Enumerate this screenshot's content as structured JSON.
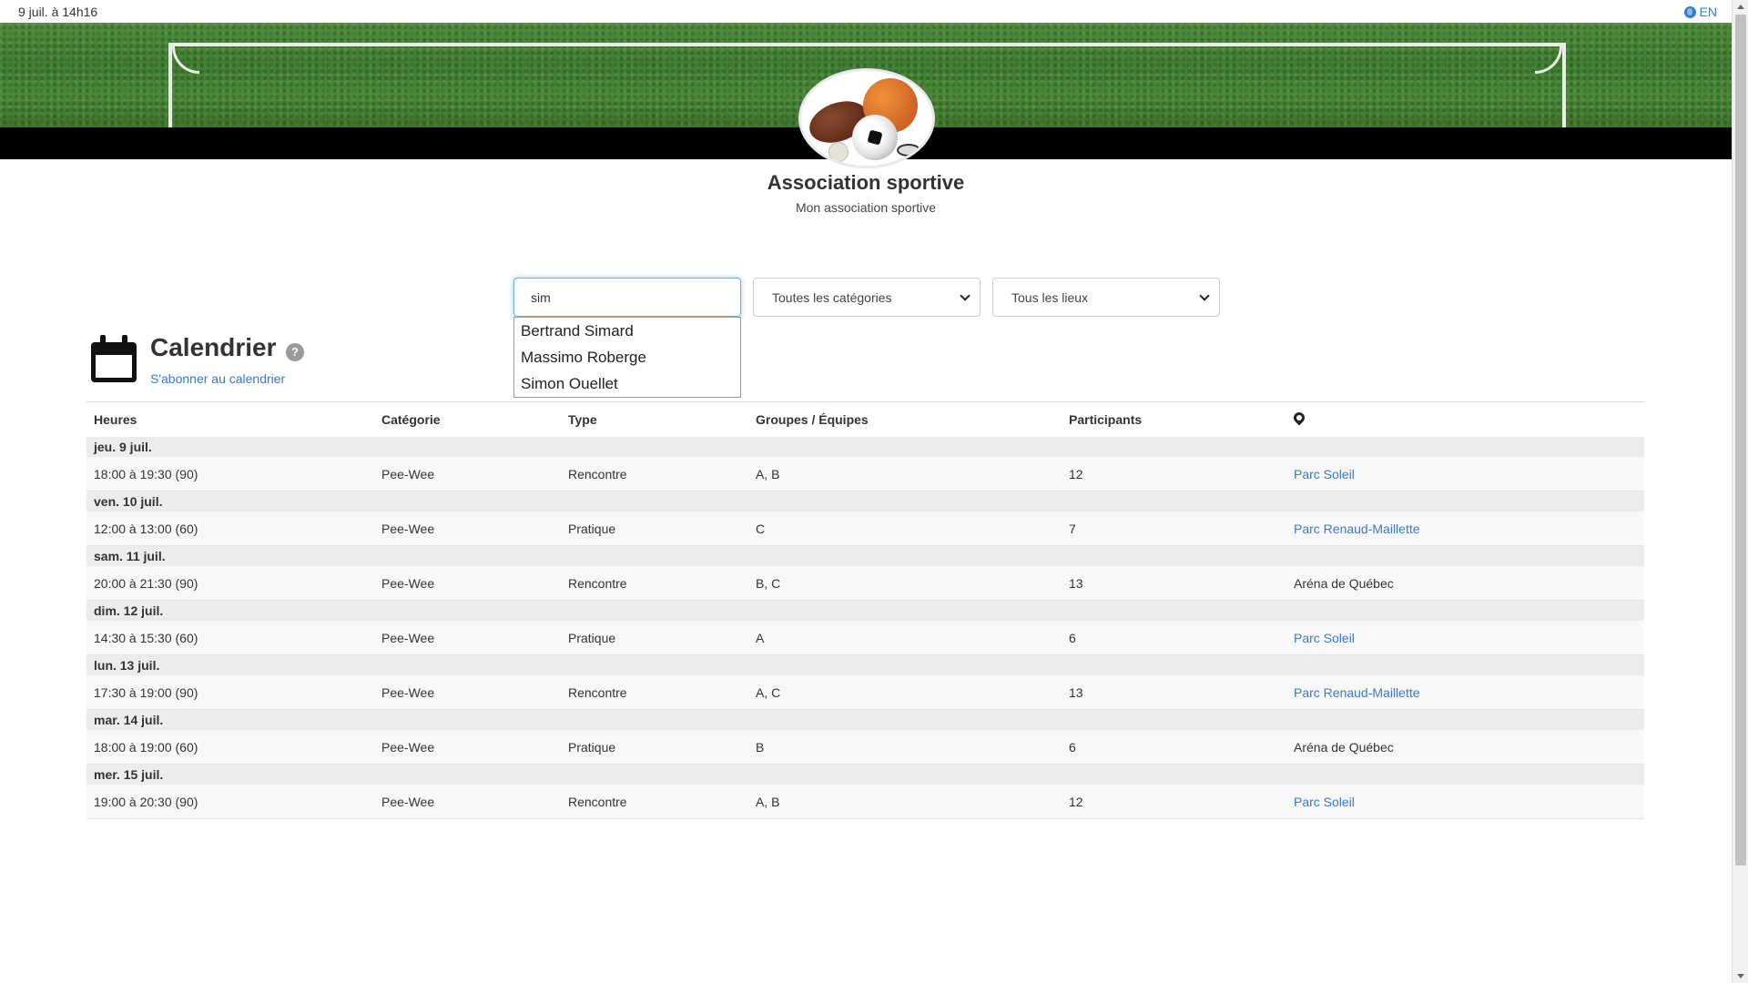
{
  "topbar": {
    "datetime": "9 juil. à 14h16",
    "lang": "EN"
  },
  "org": {
    "name": "Association sportive",
    "subtitle": "Mon association sportive"
  },
  "filters": {
    "search_value": "sim",
    "category": "Toutes les catégories",
    "location": "Tous les lieux"
  },
  "autocomplete": [
    "Bertrand Simard",
    "Massimo Roberge",
    "Simon Ouellet"
  ],
  "calendar": {
    "title": "Calendrier",
    "help": "?",
    "subscribe": "S'abonner au calendrier"
  },
  "table": {
    "headers": [
      "Heures",
      "Catégorie",
      "Type",
      "Groupes / Équipes",
      "Participants"
    ],
    "days": [
      {
        "label": "jeu. 9 juil.",
        "events": [
          {
            "time": "18:00 à 19:30 (90)",
            "category": "Pee-Wee",
            "type": "Rencontre",
            "groups": "A, B",
            "participants": "12",
            "location": "Parc Soleil",
            "location_link": true
          }
        ]
      },
      {
        "label": "ven. 10 juil.",
        "events": [
          {
            "time": "12:00 à 13:00 (60)",
            "category": "Pee-Wee",
            "type": "Pratique",
            "groups": "C",
            "participants": "7",
            "location": "Parc Renaud-Maillette",
            "location_link": true
          }
        ]
      },
      {
        "label": "sam. 11 juil.",
        "events": [
          {
            "time": "20:00 à 21:30 (90)",
            "category": "Pee-Wee",
            "type": "Rencontre",
            "groups": "B, C",
            "participants": "13",
            "location": "Aréna de Québec",
            "location_link": false
          }
        ]
      },
      {
        "label": "dim. 12 juil.",
        "events": [
          {
            "time": "14:30 à 15:30 (60)",
            "category": "Pee-Wee",
            "type": "Pratique",
            "groups": "A",
            "participants": "6",
            "location": "Parc Soleil",
            "location_link": true
          }
        ]
      },
      {
        "label": "lun. 13 juil.",
        "events": [
          {
            "time": "17:30 à 19:00 (90)",
            "category": "Pee-Wee",
            "type": "Rencontre",
            "groups": "A, C",
            "participants": "13",
            "location": "Parc Renaud-Maillette",
            "location_link": true
          }
        ]
      },
      {
        "label": "mar. 14 juil.",
        "events": [
          {
            "time": "18:00 à 19:00 (60)",
            "category": "Pee-Wee",
            "type": "Pratique",
            "groups": "B",
            "participants": "6",
            "location": "Aréna de Québec",
            "location_link": false
          }
        ]
      },
      {
        "label": "mer. 15 juil.",
        "events": [
          {
            "time": "19:00 à 20:30 (90)",
            "category": "Pee-Wee",
            "type": "Rencontre",
            "groups": "A, B",
            "participants": "12",
            "location": "Parc Soleil",
            "location_link": true
          }
        ]
      }
    ]
  },
  "colors": {
    "link": "#3a7bc8",
    "header_bar": "#000000",
    "day_row": "#ececec"
  }
}
